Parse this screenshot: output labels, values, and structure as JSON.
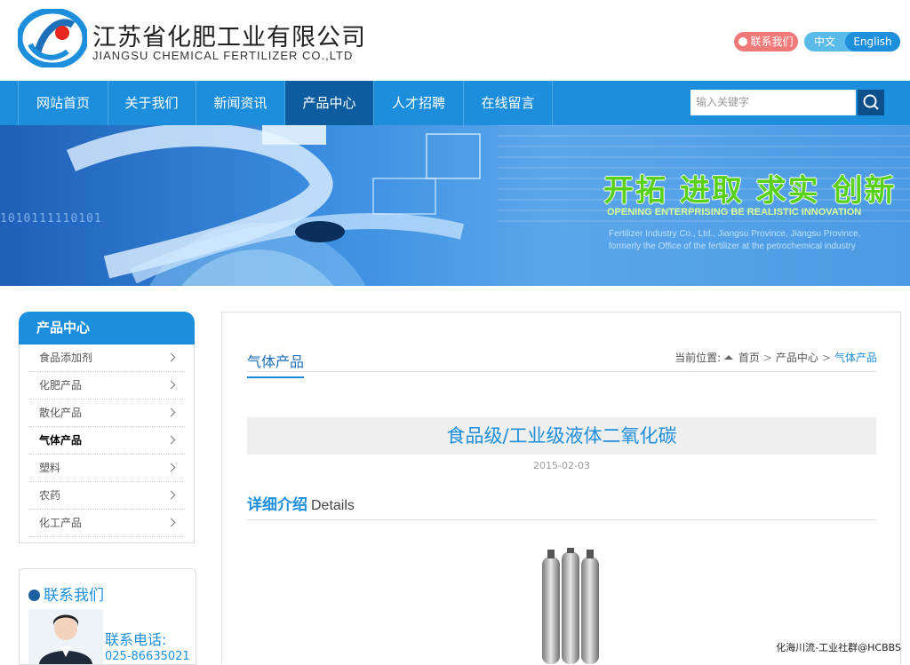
{
  "header": {
    "company_cn": "江苏省化肥工业有限公司",
    "company_en": "JIANGSU CHEMICAL FERTILIZER CO.,LTD",
    "contact_button": "联系我们",
    "lang_zh": "中文",
    "lang_en": "English"
  },
  "nav": {
    "items": [
      {
        "label": "网站首页"
      },
      {
        "label": "关于我们"
      },
      {
        "label": "新闻资讯"
      },
      {
        "label": "产品中心"
      },
      {
        "label": "人才招聘"
      },
      {
        "label": "在线留言"
      }
    ],
    "active": "产品中心",
    "search_placeholder": "输入关键字"
  },
  "banner": {
    "slogan": "开拓 进取 求实 创新",
    "slogan_en": "OPENING ENTERPRISING BE REALISTIC INNOVATION",
    "small_text_1": "Fertilizer Industry Co., Ltd., Jiangsu Province, Jiangsu Province,",
    "small_text_2": "formerly the Office of the fertilizer at the petrochemical industry",
    "binary": "1010111110101"
  },
  "sidebar": {
    "title": "产品中心",
    "items": [
      {
        "label": "食品添加剂"
      },
      {
        "label": "化肥产品"
      },
      {
        "label": "散化产品"
      },
      {
        "label": "气体产品"
      },
      {
        "label": "塑料"
      },
      {
        "label": "农药"
      },
      {
        "label": "化工产品"
      }
    ],
    "active": "气体产品"
  },
  "contact": {
    "title": "联系我们",
    "phone_label": "联系电话:",
    "phone": "025-86635021"
  },
  "main": {
    "section_title": "气体产品",
    "breadcrumb_prefix": "当前位置:",
    "breadcrumb": [
      "首页",
      "产品中心",
      "气体产品"
    ],
    "article_title": "食品级/工业级液体二氧化碳",
    "article_date": "2015-02-03",
    "details_cn": "详细介绍",
    "details_en": "Details"
  },
  "watermark": "化海川流-工业社群@HCBBS",
  "colors": {
    "primary": "#1c8edb",
    "nav_active": "#0d5c9f",
    "slogan_green": "#59d11a"
  }
}
